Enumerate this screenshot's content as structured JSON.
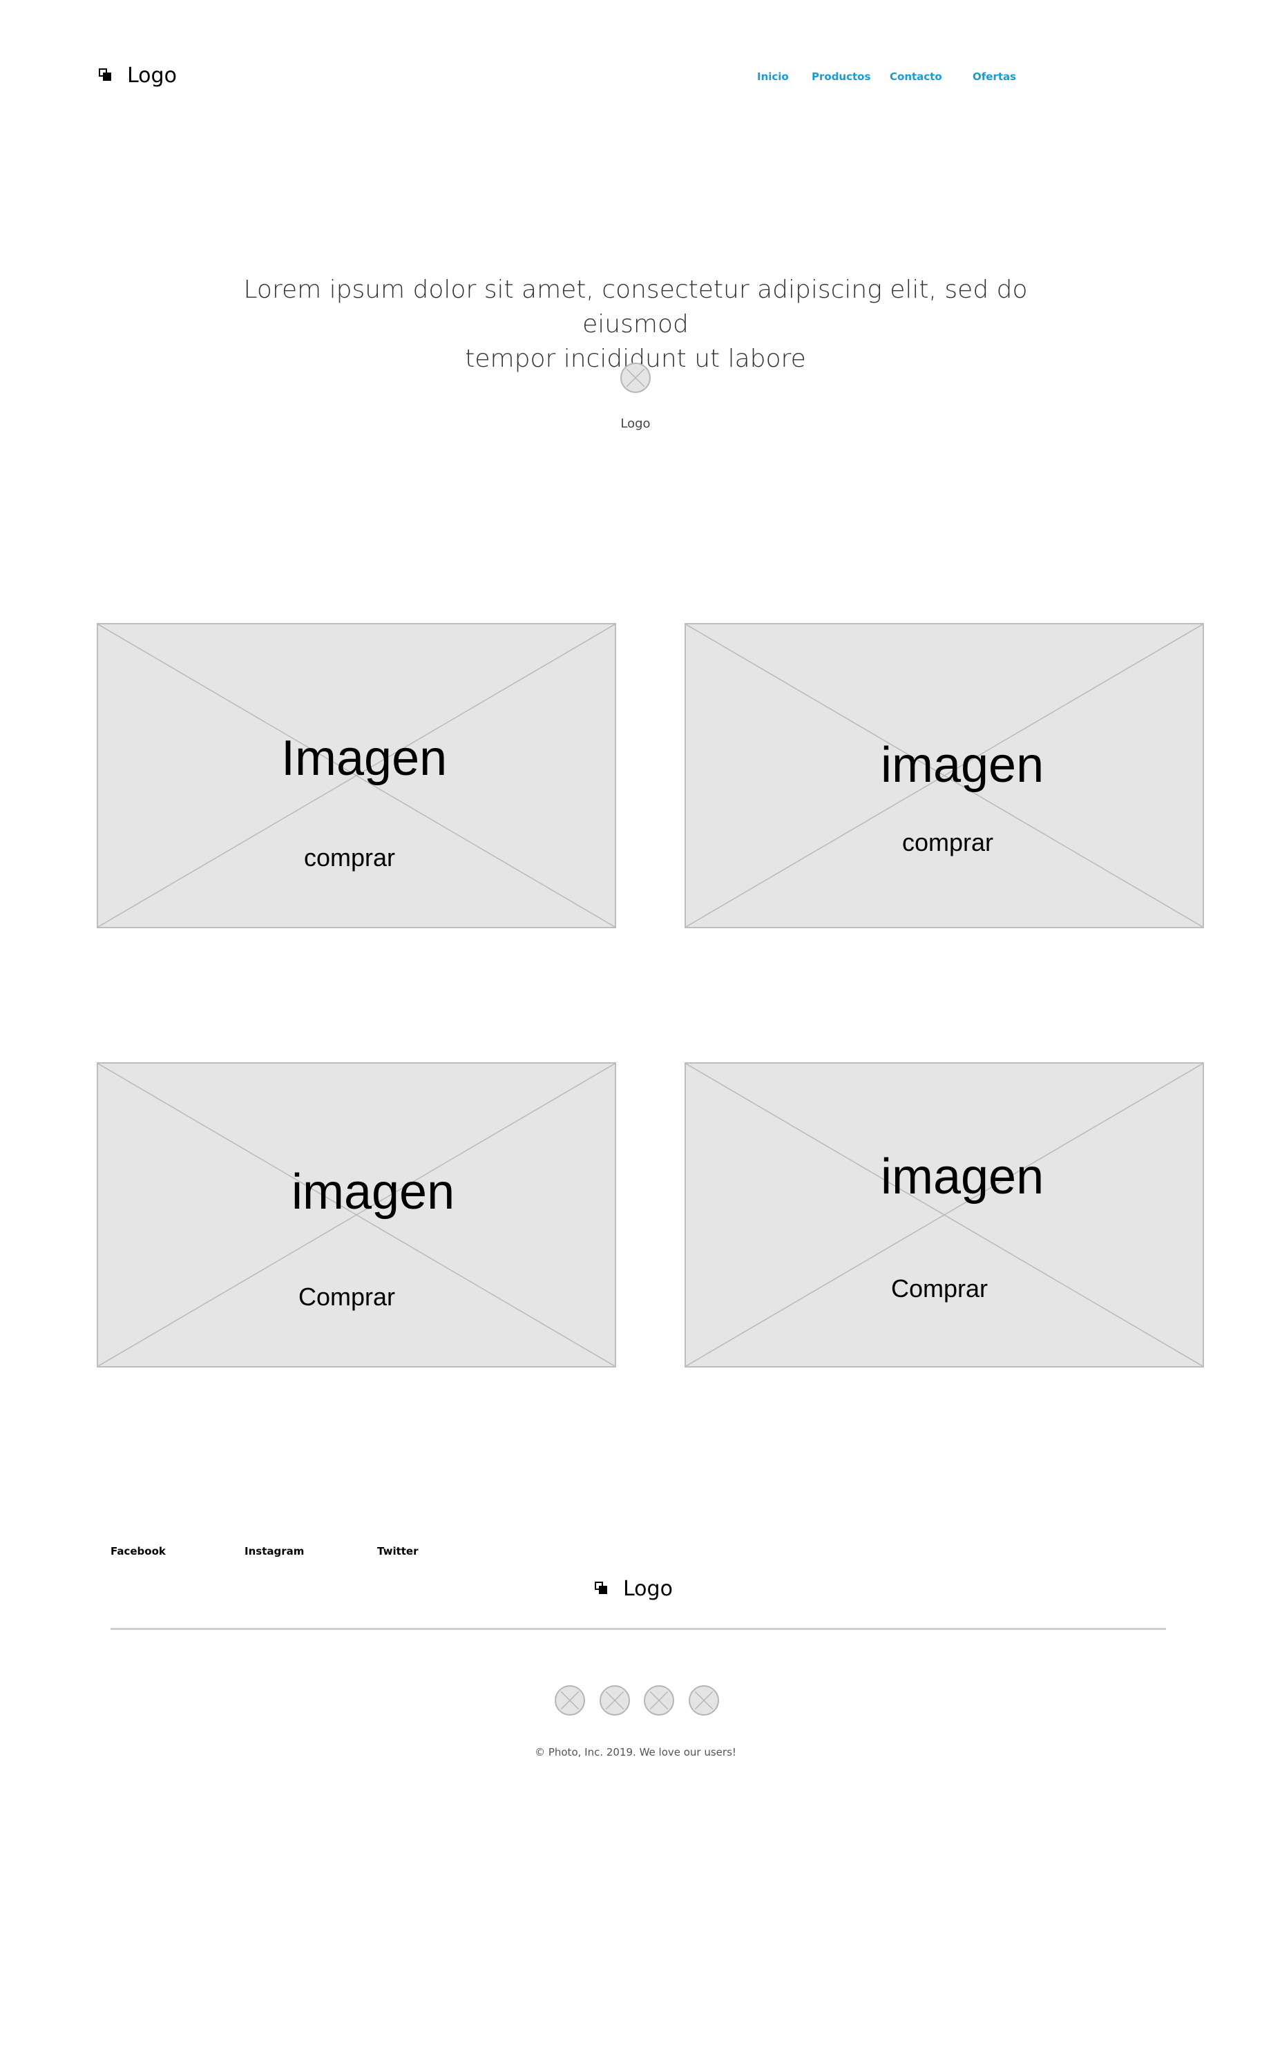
{
  "header": {
    "logo_text": "Logo",
    "nav": [
      {
        "label": "Inicio"
      },
      {
        "label": "Productos"
      },
      {
        "label": "Contacto"
      },
      {
        "label": "Ofertas"
      }
    ],
    "nav_color": "#1a9bd6"
  },
  "hero": {
    "text_line1": "Lorem ipsum dolor sit amet, consectetur adipiscing elit, sed do eiusmod",
    "text_line2": "tempor incididunt ut labore",
    "logo_label": "Logo"
  },
  "cards": [
    {
      "title": "Imagen",
      "button": "comprar"
    },
    {
      "title": "imagen",
      "button": "comprar"
    },
    {
      "title": "imagen",
      "button": "Comprar"
    },
    {
      "title": "imagen",
      "button": "Comprar"
    }
  ],
  "footer": {
    "links": [
      {
        "label": "Facebook"
      },
      {
        "label": "Instagram"
      },
      {
        "label": "Twitter"
      }
    ],
    "logo_text": "Logo",
    "social_icons": [
      "placeholder-icon",
      "placeholder-icon",
      "placeholder-icon",
      "placeholder-icon"
    ],
    "copyright": "© Photo, Inc. 2019. We love our users!"
  },
  "colors": {
    "placeholder_fill": "#e5e5e5",
    "placeholder_stroke": "#bdbdbd"
  }
}
